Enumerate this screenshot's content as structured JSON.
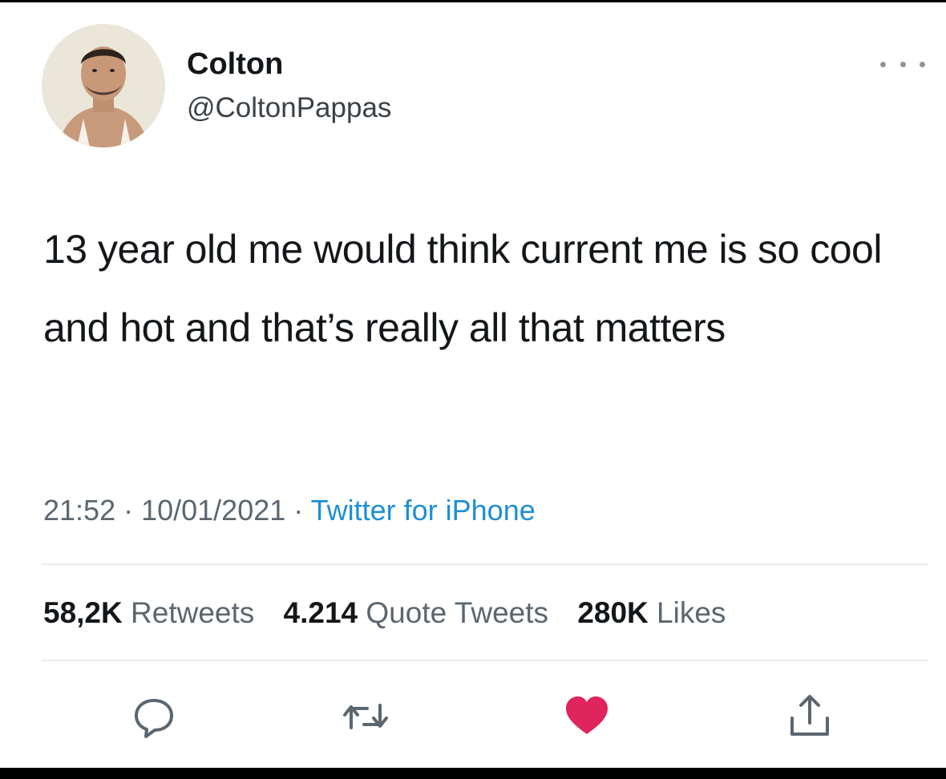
{
  "tweet": {
    "display_name": "Colton",
    "handle": "@ColtonPappas",
    "text": "13 year old me would think current me is so cool and hot and that’s really all that matters",
    "time": "21:52",
    "date": "10/01/2021",
    "separator": " · ",
    "source": "Twitter for iPhone"
  },
  "stats": {
    "retweets_count": "58,2K",
    "retweets_label": "Retweets",
    "quotes_count": "4.214",
    "quotes_label": "Quote Tweets",
    "likes_count": "280K",
    "likes_label": "Likes"
  },
  "actions": {
    "reply_icon": "reply-icon",
    "retweet_icon": "retweet-icon",
    "like_icon": "heart-icon",
    "share_icon": "share-icon"
  },
  "colors": {
    "text": "#14171a",
    "secondary": "#5b6670",
    "link": "#1d8fd6",
    "like": "#e0245e",
    "divider": "#e6ecf0"
  }
}
